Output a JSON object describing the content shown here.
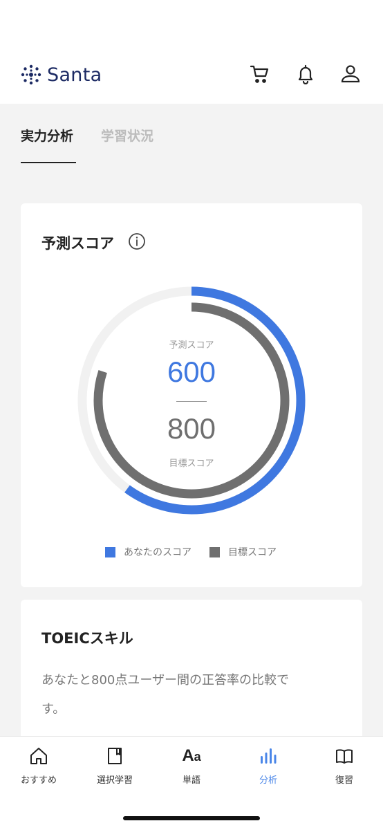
{
  "header": {
    "logo_text": "Santa",
    "icons": [
      "cart-icon",
      "bell-icon",
      "user-icon"
    ]
  },
  "tabs": {
    "active_label": "実力分析",
    "inactive_label": "学習状況"
  },
  "score_card": {
    "title": "予測スコア",
    "predicted_label": "予測スコア",
    "predicted_value": "600",
    "target_label": "目標スコア",
    "target_value": "800",
    "legend": {
      "yours": "あなたのスコア",
      "target": "目標スコア"
    },
    "colors": {
      "yours": "#3f78e0",
      "target": "#6f6f6f",
      "track": "#f1f1f1"
    },
    "outer_fraction": 0.6,
    "inner_fraction": 0.8
  },
  "skill_card": {
    "title": "TOEICスキル",
    "description": "あなたと800点ユーザー間の正答率の比較です。"
  },
  "bottom_nav": {
    "items": [
      {
        "label": "おすすめ",
        "icon": "home-icon"
      },
      {
        "label": "選択学習",
        "icon": "book-single-icon"
      },
      {
        "label": "単語",
        "icon": "aa-icon",
        "glyph_big": "A",
        "glyph_small": "a"
      },
      {
        "label": "分析",
        "icon": "analytics-icon"
      },
      {
        "label": "復習",
        "icon": "open-book-icon"
      }
    ],
    "active_index": 3,
    "active_color": "#4a86e8"
  }
}
